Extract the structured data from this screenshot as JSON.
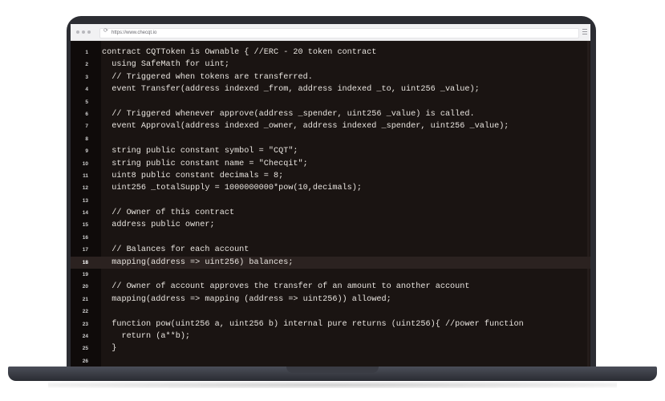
{
  "browser": {
    "url": "https://www.checqt.io"
  },
  "editor": {
    "highlighted_line": 18,
    "lines": [
      {
        "num": "1",
        "text": "contract CQTToken is Ownable { //ERC - 20 token contract"
      },
      {
        "num": "2",
        "text": "  using SafeMath for uint;"
      },
      {
        "num": "3",
        "text": "  // Triggered when tokens are transferred."
      },
      {
        "num": "4",
        "text": "  event Transfer(address indexed _from, address indexed _to, uint256 _value);"
      },
      {
        "num": "5",
        "text": ""
      },
      {
        "num": "6",
        "text": "  // Triggered whenever approve(address _spender, uint256 _value) is called."
      },
      {
        "num": "7",
        "text": "  event Approval(address indexed _owner, address indexed _spender, uint256 _value);"
      },
      {
        "num": "8",
        "text": ""
      },
      {
        "num": "9",
        "text": "  string public constant symbol = \"CQT\";"
      },
      {
        "num": "10",
        "text": "  string public constant name = \"Checqit\";"
      },
      {
        "num": "11",
        "text": "  uint8 public constant decimals = 8;"
      },
      {
        "num": "12",
        "text": "  uint256 _totalSupply = 1000000000*pow(10,decimals);"
      },
      {
        "num": "13",
        "text": ""
      },
      {
        "num": "14",
        "text": "  // Owner of this contract"
      },
      {
        "num": "15",
        "text": "  address public owner;"
      },
      {
        "num": "16",
        "text": ""
      },
      {
        "num": "17",
        "text": "  // Balances for each account"
      },
      {
        "num": "18",
        "text": "  mapping(address => uint256) balances;"
      },
      {
        "num": "19",
        "text": ""
      },
      {
        "num": "20",
        "text": "  // Owner of account approves the transfer of an amount to another account"
      },
      {
        "num": "21",
        "text": "  mapping(address => mapping (address => uint256)) allowed;"
      },
      {
        "num": "22",
        "text": ""
      },
      {
        "num": "23",
        "text": "  function pow(uint256 a, uint256 b) internal pure returns (uint256){ //power function"
      },
      {
        "num": "24",
        "text": "    return (a**b);"
      },
      {
        "num": "25",
        "text": "  }"
      },
      {
        "num": "26",
        "text": ""
      }
    ]
  }
}
